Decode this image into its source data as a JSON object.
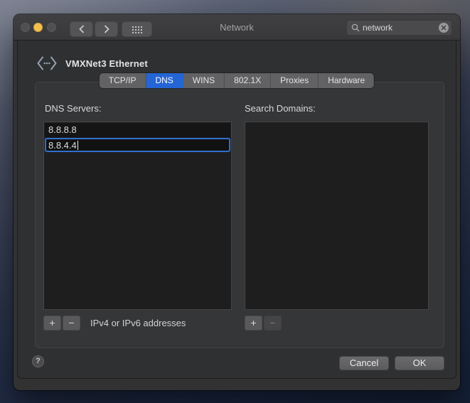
{
  "colors": {
    "accent_blue": "#2465d6",
    "focus_ring_blue": "#2f6fd0",
    "traffic_minimize_yellow": "#f5bf4e",
    "traffic_disabled_gray": "#505052"
  },
  "titlebar": {
    "title": "Network",
    "search_value": "network"
  },
  "sheet": {
    "service_name": "VMXNet3 Ethernet",
    "tabs": [
      {
        "label": "TCP/IP",
        "selected": false
      },
      {
        "label": "DNS",
        "selected": true
      },
      {
        "label": "WINS",
        "selected": false
      },
      {
        "label": "802.1X",
        "selected": false
      },
      {
        "label": "Proxies",
        "selected": false
      },
      {
        "label": "Hardware",
        "selected": false
      }
    ],
    "dns_servers": {
      "label": "DNS Servers:",
      "rows": [
        "8.8.8.8",
        "8.8.4.4"
      ],
      "editing_row_index": 1,
      "hint": "IPv4 or IPv6 addresses"
    },
    "search_domains": {
      "label": "Search Domains:",
      "rows": []
    },
    "list_controls": {
      "add": "+",
      "remove": "−"
    },
    "footer": {
      "help": "?",
      "cancel": "Cancel",
      "ok": "OK"
    }
  }
}
